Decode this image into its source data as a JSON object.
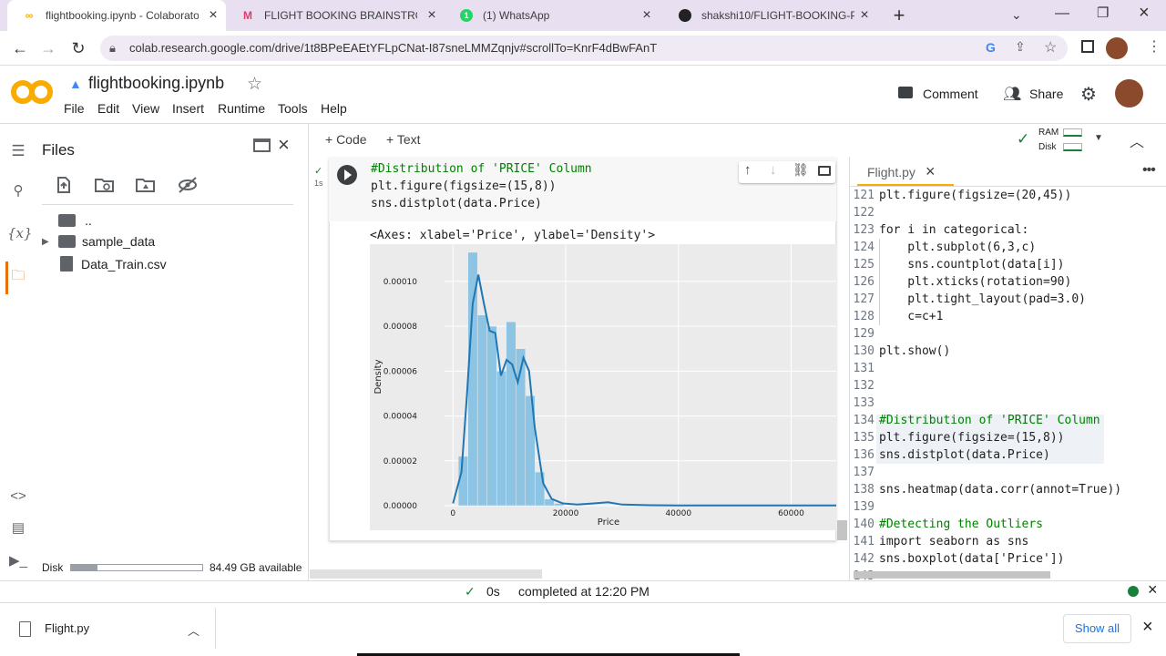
{
  "browser": {
    "tabs": [
      {
        "title": "flightbooking.ipynb - Colaborato",
        "icon": "colab-icon"
      },
      {
        "title": "FLIGHT BOOKING BRAINSTROM",
        "icon": "miro-icon"
      },
      {
        "title": "(1) WhatsApp",
        "icon": "whatsapp-icon"
      },
      {
        "title": "shakshi10/FLIGHT-BOOKING-PR",
        "icon": "github-icon"
      }
    ],
    "url": "colab.research.google.com/drive/1t8BPeEAEtYFLpCNat-I87sneLMMZqnjv#scrollTo=KnrF4dBwFAnT"
  },
  "colab": {
    "notebook_title": "flightbooking.ipynb",
    "menu": [
      "File",
      "Edit",
      "View",
      "Insert",
      "Runtime",
      "Tools",
      "Help"
    ],
    "comment_label": "Comment",
    "share_label": "Share",
    "add_code": "+ Code",
    "add_text": "+ Text",
    "ram_label": "RAM",
    "disk_label": "Disk"
  },
  "files": {
    "title": "Files",
    "items": [
      {
        "name": "..",
        "icon": "folder-up-icon"
      },
      {
        "name": "sample_data",
        "icon": "folder-icon"
      },
      {
        "name": "Data_Train.csv",
        "icon": "file-icon"
      }
    ],
    "disk_label": "Disk",
    "disk_available": "84.49 GB available",
    "disk_used_fraction": 0.2
  },
  "cell": {
    "exec_time": "1s",
    "code": [
      "#Distribution of 'PRICE' Column",
      "plt.figure(figsize=(15,8))",
      "sns.distplot(data.Price)"
    ],
    "output_text": "<Axes: xlabel='Price', ylabel='Density'>"
  },
  "chart_data": {
    "type": "bar",
    "xlabel": "Price",
    "ylabel": "Density",
    "xlim": [
      -1500,
      68000
    ],
    "ylim": [
      0,
      0.000115
    ],
    "xticks": [
      0,
      20000,
      40000,
      60000
    ],
    "xtick_labels": [
      "0",
      "20000",
      "40000",
      "60000"
    ],
    "yticks": [
      0,
      2e-05,
      4e-05,
      6e-05,
      8e-05,
      0.0001
    ],
    "ytick_labels": [
      "0.00000",
      "0.00002",
      "0.00004",
      "0.00006",
      "0.00008",
      "0.00010"
    ],
    "hist_x": [
      1800,
      3500,
      5200,
      6900,
      8600,
      10300,
      12000,
      13700,
      15400,
      17100,
      18800
    ],
    "hist_y": [
      2.2e-05,
      0.000113,
      8.5e-05,
      8e-05,
      6e-05,
      8.2e-05,
      7e-05,
      4.9e-05,
      1.5e-05,
      3e-06,
      1e-06
    ],
    "kde_x": [
      0,
      1500,
      2500,
      3500,
      4500,
      5500,
      6500,
      7500,
      8500,
      9500,
      10500,
      11500,
      12500,
      13500,
      14500,
      16000,
      17500,
      19500,
      22000,
      25000,
      27500,
      30000,
      35000,
      40000,
      50000,
      60000,
      68000
    ],
    "kde_y": [
      1e-06,
      1.5e-05,
      5e-05,
      9e-05,
      0.000103,
      9e-05,
      7.8e-05,
      7.7e-05,
      5.8e-05,
      6.5e-05,
      6.3e-05,
      5.5e-05,
      6.6e-05,
      6e-05,
      3.5e-05,
      1e-05,
      3e-06,
      1e-06,
      5e-07,
      1e-06,
      1.5e-06,
      5e-07,
      2e-07,
      1e-07,
      1e-07,
      1e-07,
      1e-07
    ],
    "grid": true,
    "hist_color": "#8ec4e3",
    "kde_color": "#1f77b4"
  },
  "editor": {
    "filename": "Flight.py",
    "lines": [
      {
        "n": "121",
        "t": "plt.figure(figsize=(20,45))"
      },
      {
        "n": "122",
        "t": ""
      },
      {
        "n": "123",
        "t": "for i in categorical:"
      },
      {
        "n": "124",
        "t": "    plt.subplot(6,3,c)"
      },
      {
        "n": "125",
        "t": "    sns.countplot(data[i])"
      },
      {
        "n": "126",
        "t": "    plt.xticks(rotation=90)"
      },
      {
        "n": "127",
        "t": "    plt.tight_layout(pad=3.0)"
      },
      {
        "n": "128",
        "t": "    c=c+1"
      },
      {
        "n": "129",
        "t": ""
      },
      {
        "n": "130",
        "t": "plt.show()"
      },
      {
        "n": "131",
        "t": ""
      },
      {
        "n": "132",
        "t": ""
      },
      {
        "n": "133",
        "t": ""
      },
      {
        "n": "134",
        "t": "#Distribution of 'PRICE' Column"
      },
      {
        "n": "135",
        "t": "plt.figure(figsize=(15,8))"
      },
      {
        "n": "136",
        "t": "sns.distplot(data.Price)"
      },
      {
        "n": "137",
        "t": ""
      },
      {
        "n": "138",
        "t": "sns.heatmap(data.corr(annot=True))"
      },
      {
        "n": "139",
        "t": ""
      },
      {
        "n": "140",
        "t": "#Detecting the Outliers"
      },
      {
        "n": "141",
        "t": "import seaborn as sns"
      },
      {
        "n": "142",
        "t": "sns.boxplot(data['Price'])"
      },
      {
        "n": "143",
        "t": ""
      }
    ]
  },
  "status": {
    "time": "0s",
    "message": "completed at 12:20 PM"
  },
  "downloads": {
    "file": "Flight.py",
    "show_all": "Show all"
  }
}
